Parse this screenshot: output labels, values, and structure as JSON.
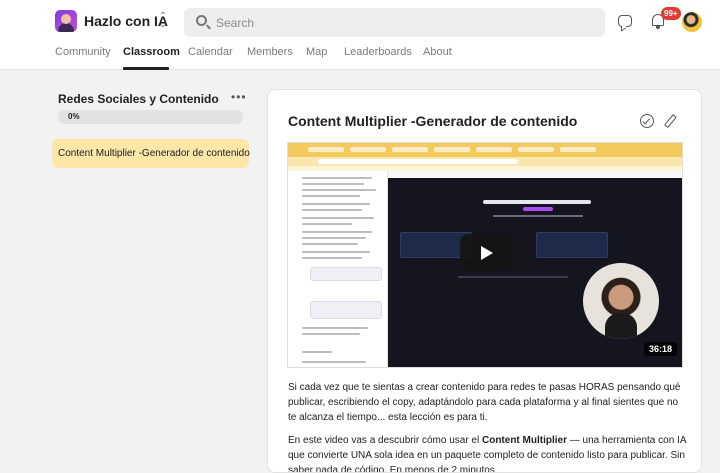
{
  "header": {
    "group_name": "Hazlo con IA",
    "search_placeholder": "Search",
    "notifications_count": "99+"
  },
  "nav": {
    "tabs": [
      {
        "label": "Community"
      },
      {
        "label": "Classroom"
      },
      {
        "label": "Calendar"
      },
      {
        "label": "Members"
      },
      {
        "label": "Map"
      },
      {
        "label": "Leaderboards"
      },
      {
        "label": "About"
      }
    ],
    "active": "Classroom"
  },
  "sidebar": {
    "course_title": "Redes Sociales y Contenido",
    "progress_text": "0%",
    "progress": 0,
    "lessons": [
      {
        "label": "Content Multiplier -Generador de contenido",
        "selected": true
      }
    ]
  },
  "lesson": {
    "title": "Content Multiplier -Generador de contenido",
    "video_duration": "36:18",
    "paragraph1": "Si cada vez que te sientas a crear contenido para redes te pasas HORAS pensando qué publicar, escribiendo el copy, adaptándolo para cada plataforma y al final sientes que no te alcanza el tiempo... esta lección es para ti.",
    "paragraph2_before": "En este video vas a descubrir cómo usar el ",
    "paragraph2_bold": "Content Multiplier",
    "paragraph2_after": " — una herramienta con IA que convierte UNA sola idea en un paquete completo de contenido listo para publicar. Sin saber nada de código. En menos de 2 minutos."
  },
  "colors": {
    "active_lesson_bg": "#fce7a6",
    "notification_badge": "#e53935",
    "video_dark": "#151520"
  }
}
